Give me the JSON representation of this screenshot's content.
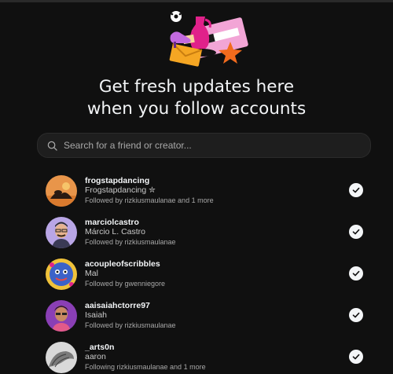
{
  "headline": {
    "line1": "Get fresh updates here",
    "line2": "when you follow accounts"
  },
  "search": {
    "placeholder": "Search for a friend or creator..."
  },
  "accounts": [
    {
      "username": "frogstapdancing",
      "full_name": "Frogstapdancing ✮",
      "followed_by": "Followed by rizkiusmaulanae and 1 more",
      "following": true
    },
    {
      "username": "marciolcastro",
      "full_name": "Márcio L. Castro",
      "followed_by": "Followed by rizkiusmaulanae",
      "following": true
    },
    {
      "username": "acoupleofscribbles",
      "full_name": "Mal",
      "followed_by": "Followed by gwenniegore",
      "following": true
    },
    {
      "username": "aaisaiahctorre97",
      "full_name": "Isaiah",
      "followed_by": "Followed by rizkiusmaulanae",
      "following": true
    },
    {
      "username": "_arts0n",
      "full_name": "aaron",
      "followed_by": "Following rizkiusmaulanae and 1 more",
      "following": true
    }
  ]
}
